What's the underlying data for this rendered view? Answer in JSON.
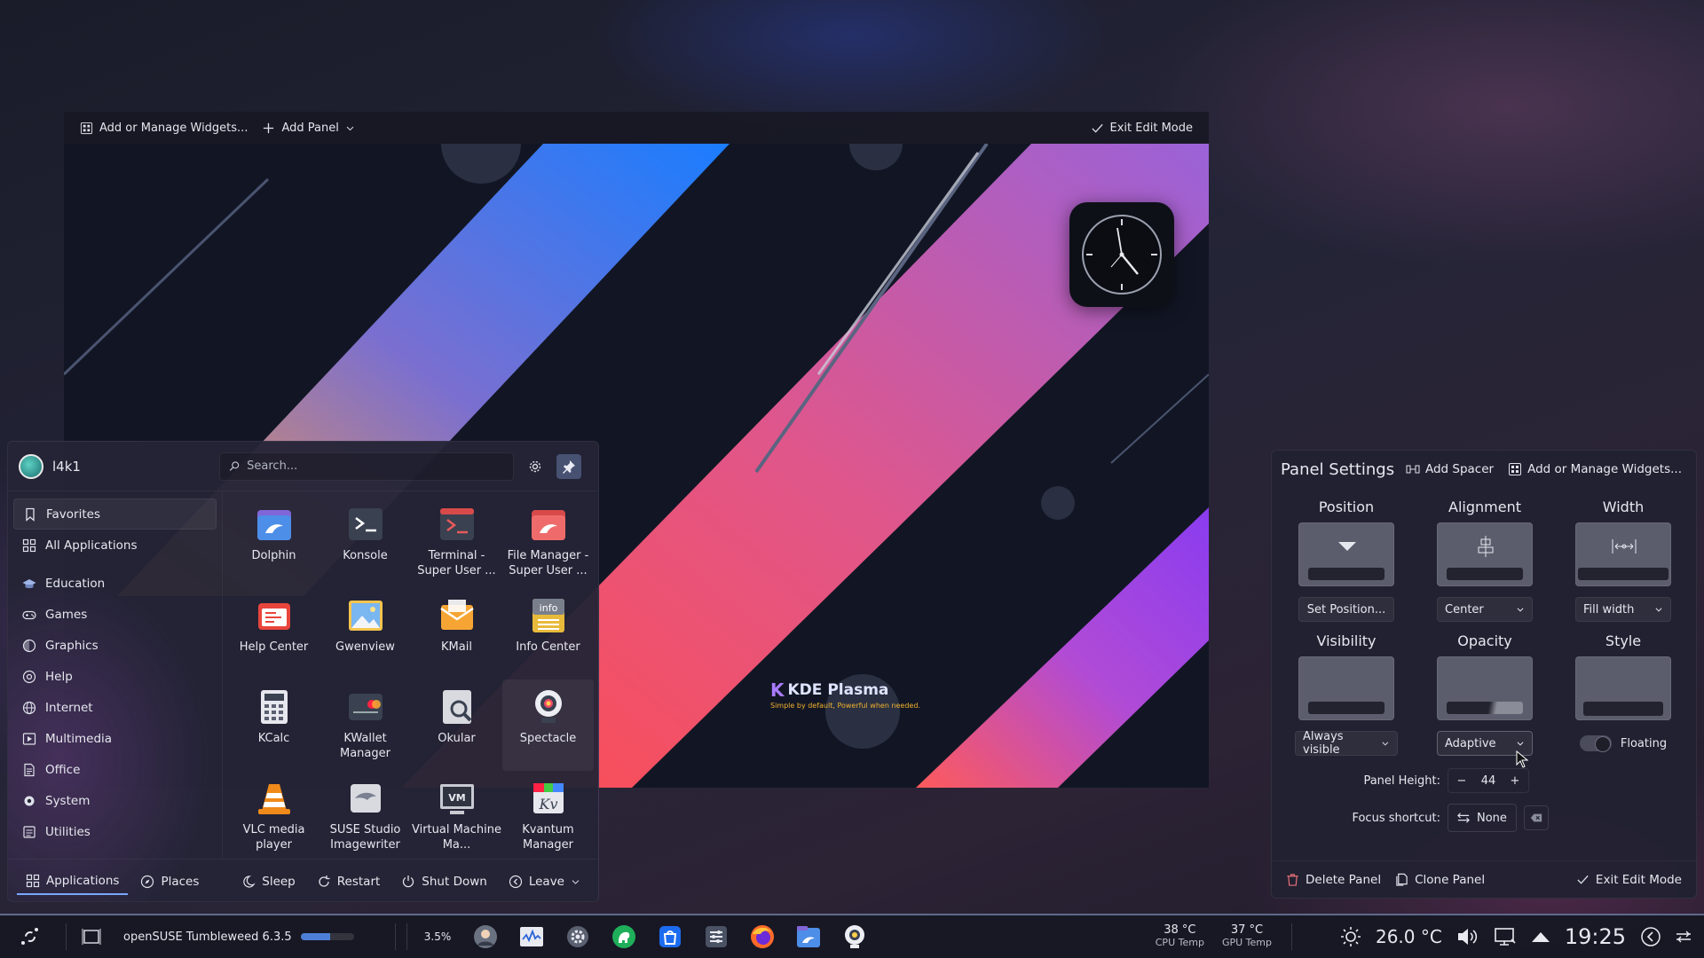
{
  "edit_toolbar": {
    "add_widgets": "Add or Manage Widgets...",
    "add_panel": "Add Panel",
    "exit_edit": "Exit Edit Mode"
  },
  "desktop": {
    "logo_name": "KDE Plasma",
    "logo_tagline": "Simple by default, Powerful when needed."
  },
  "launcher": {
    "user": "l4k1",
    "search_placeholder": "Search...",
    "categories": [
      "Favorites",
      "All Applications",
      "Education",
      "Games",
      "Graphics",
      "Help",
      "Internet",
      "Multimedia",
      "Office",
      "System",
      "Utilities"
    ],
    "apps": [
      {
        "name": "Dolphin",
        "icon": "dolphin-icon"
      },
      {
        "name": "Konsole",
        "icon": "konsole-icon"
      },
      {
        "name": "Terminal - Super User ...",
        "icon": "terminal-su-icon"
      },
      {
        "name": "File Manager - Super User ...",
        "icon": "file-manager-su-icon"
      },
      {
        "name": "Help Center",
        "icon": "help-center-icon"
      },
      {
        "name": "Gwenview",
        "icon": "gwenview-icon"
      },
      {
        "name": "KMail",
        "icon": "kmail-icon"
      },
      {
        "name": "Info Center",
        "icon": "info-center-icon"
      },
      {
        "name": "KCalc",
        "icon": "kcalc-icon"
      },
      {
        "name": "KWallet Manager",
        "icon": "kwallet-icon"
      },
      {
        "name": "Okular",
        "icon": "okular-icon"
      },
      {
        "name": "Spectacle",
        "icon": "spectacle-icon"
      },
      {
        "name": "VLC media player",
        "icon": "vlc-icon"
      },
      {
        "name": "SUSE Studio Imagewriter",
        "icon": "imagewriter-icon"
      },
      {
        "name": "Virtual Machine Ma...",
        "icon": "virt-manager-icon"
      },
      {
        "name": "Kvantum Manager",
        "icon": "kvantum-icon"
      }
    ],
    "footer": {
      "applications": "Applications",
      "places": "Places",
      "sleep": "Sleep",
      "restart": "Restart",
      "shutdown": "Shut Down",
      "leave": "Leave"
    }
  },
  "panel_settings": {
    "title": "Panel Settings",
    "add_spacer": "Add Spacer",
    "add_widgets": "Add or Manage Widgets...",
    "position": {
      "label": "Position",
      "value": "Set Position..."
    },
    "alignment": {
      "label": "Alignment",
      "value": "Center"
    },
    "width": {
      "label": "Width",
      "value": "Fill width"
    },
    "visibility": {
      "label": "Visibility",
      "value": "Always visible"
    },
    "opacity": {
      "label": "Opacity",
      "value": "Adaptive"
    },
    "style": {
      "label": "Style",
      "value": "Floating",
      "enabled": false
    },
    "height_label": "Panel Height:",
    "height_value": "44",
    "shortcut_label": "Focus shortcut:",
    "shortcut_value": "None",
    "delete": "Delete Panel",
    "clone": "Clone Panel",
    "exit": "Exit Edit Mode"
  },
  "taskbar": {
    "task_title": "openSUSE Tumbleweed 6.3.5",
    "task_progress": 0.55,
    "cpu_usage": "3.5%",
    "cpu_temp": "38 °C",
    "cpu_temp_label": "CPU Temp",
    "gpu_temp": "37 °C",
    "gpu_temp_label": "GPU Temp",
    "weather": "26.0 °C",
    "clock": "19:25"
  },
  "colors": {
    "accent": "#7aa7ff",
    "panel_border": "#5f6a8c"
  }
}
